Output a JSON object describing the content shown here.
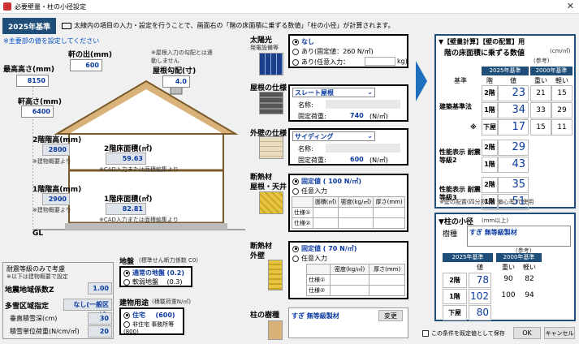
{
  "window": {
    "title": "必要壁量・柱の小径設定",
    "close": "✕"
  },
  "std_label": "2025年基準",
  "hint": "太線内の項目の入力・設定を行うことで、画面右の「階の床面積に乗ずる数値」「柱の小径」が計算されます。",
  "required_note": "※主要部の値を設定してください",
  "dims": {
    "max_height_label": "最高高さ(mm)",
    "max_height": "8150",
    "eave_label": "軒の出(mm)",
    "eave": "600",
    "roof_pitch_note": "※屋根入力の勾配とは連動しません",
    "roof_pitch_label": "屋根勾配(寸)",
    "roof_pitch": "4.0",
    "eave_height_label": "軒高さ(mm)",
    "eave_height": "6400",
    "f2_height_label": "2階階高(mm)",
    "f2_height": "2800",
    "f2_note": "※建物概要より",
    "f1_height_label": "1階階高(mm)",
    "f1_height": "2900",
    "f1_note": "※建物概要より",
    "f2_area_label": "2階床面積(㎡)",
    "f2_area": "59.63",
    "f2_area_note": "※CAD入力または面積編集より",
    "f1_area_label": "1階床面積(㎡)",
    "f1_area": "82.81",
    "f1_area_note": "※CAD入力または面積編集より",
    "gl": "GL"
  },
  "seismic": {
    "title": "耐震等級のみで考慮",
    "sub": "※以下は建物概要で設定",
    "z_label": "地震地域係数Z",
    "z": "1.00",
    "snow_label": "多雪区域指定",
    "snow": "なし(一般区域)",
    "snow_depth_label": "垂直積雪深(cm)",
    "snow_depth": "30",
    "snow_weight_label": "積雪単位荷重(N/cm/㎡)",
    "snow_weight": "20"
  },
  "ground": {
    "title": "地盤",
    "sub": "(標準せん断力係数 C0)",
    "opts": [
      {
        "label": "通常の地盤",
        "val": "(0.2)"
      },
      {
        "label": "軟弱地盤",
        "val": "(0.3)"
      }
    ]
  },
  "usage": {
    "title": "建物用途",
    "sub": "(積載荷重N/㎡)",
    "opts": [
      {
        "label": "住宅",
        "val": "(600)"
      },
      {
        "label": "非住宅 事務所等",
        "val": "(800)"
      }
    ]
  },
  "solar": {
    "title": "太陽光",
    "sub": "発電設備等",
    "opts": [
      "なし",
      "あり(固定値：260 N/㎡)",
      "あり(任意入力："
    ],
    "unit": "kg)"
  },
  "roof": {
    "title": "屋根の仕様",
    "select": "スレート屋根",
    "material_label": "名称:",
    "load_label": "固定荷重:",
    "load": "740",
    "unit": "(N/㎡)"
  },
  "wall": {
    "title": "外壁の仕様",
    "select": "サイディング",
    "material_label": "名称:",
    "load_label": "固定荷重:",
    "load": "600",
    "unit": "(N/㎡)"
  },
  "ins_roof": {
    "title": "断熱材",
    "sub": "屋根・天井",
    "opts": [
      "固定値 ( 100 N/㎡)",
      "任意入力"
    ],
    "headers": [
      "面積(㎡)",
      "密度(kg/㎥)",
      "厚さ(mm)"
    ],
    "rows": [
      "仕様①",
      "仕様②"
    ]
  },
  "ins_wall": {
    "title": "断熱材",
    "sub": "外壁",
    "opts": [
      "固定値 ( 70 N/㎡)",
      "任意入力"
    ],
    "headers": [
      "密度(kg/㎥)",
      "厚さ(mm)"
    ],
    "rows": [
      "仕様①",
      "仕様②"
    ]
  },
  "column": {
    "title": "柱の樹種",
    "value": "すぎ 無等級製材",
    "btn": "変更"
  },
  "right": {
    "head": "▼【壁量計算】【壁の配置】用",
    "sub": "階の床面積に乗ずる数値",
    "unit": "(cm/㎡)",
    "ref": "(参考)",
    "std2025": "2025年基準",
    "std2000": "2000年基準",
    "col_base": "基準",
    "col_floor": "階",
    "col_val": "値",
    "col_heavy": "重い",
    "col_light": "軽い",
    "groups": [
      {
        "label": "建築基準法",
        "rows": [
          {
            "f": "2階",
            "v": "23",
            "h": "21",
            "l": "15"
          },
          {
            "f": "1階",
            "v": "34",
            "h": "33",
            "l": "29"
          },
          {
            "f": "下屋",
            "v": "17",
            "h": "15",
            "l": "11",
            "mark": "※"
          }
        ]
      },
      {
        "label": "性能表示 耐震等級2",
        "rows": [
          {
            "f": "2階",
            "v": "29"
          },
          {
            "f": "1階",
            "v": "43"
          }
        ]
      },
      {
        "label": "性能表示 耐震等級3",
        "rows": [
          {
            "f": "2階",
            "v": "35"
          },
          {
            "f": "1階",
            "v": "51"
          }
        ]
      }
    ],
    "note": "※壁の配置(四分割法、偏心率)で使用",
    "col_head": "▼柱の小径",
    "col_unit": "(mm以上)",
    "species_label": "樹種",
    "species": "すぎ 無等級製材",
    "ref2": "(参考)",
    "cols": [
      {
        "f": "2階",
        "v": "78",
        "h": "90",
        "l": "82"
      },
      {
        "f": "1階",
        "v": "102",
        "h": "100",
        "l": "94"
      },
      {
        "f": "下屋",
        "v": "80"
      }
    ]
  },
  "footer": {
    "default_label": "この条件を既定値として保存",
    "ok": "OK",
    "cancel": "キャンセル"
  }
}
